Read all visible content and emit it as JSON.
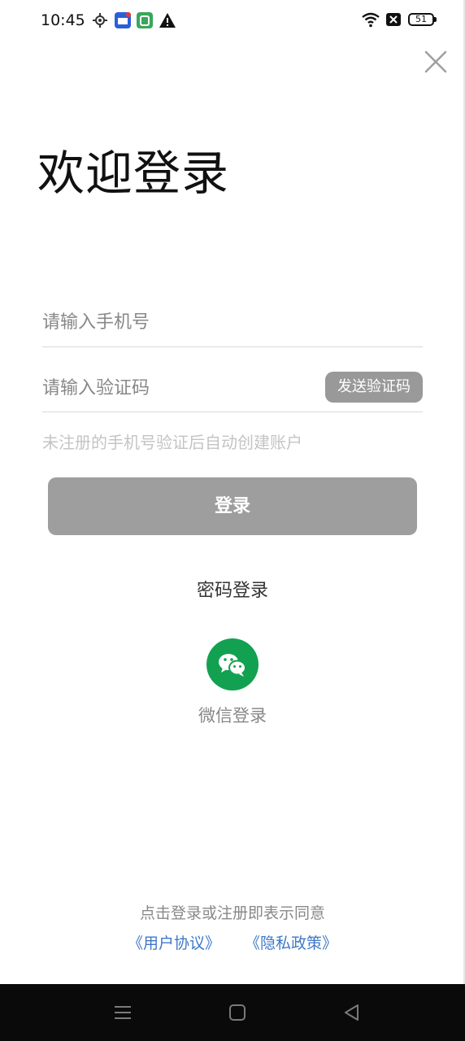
{
  "status_bar": {
    "time": "10:45",
    "battery_level": "51",
    "icons": [
      "location-icon",
      "app-notification-icon",
      "app-store-icon",
      "warning-icon",
      "wifi-icon",
      "no-sim-icon",
      "battery-icon"
    ]
  },
  "header": {
    "title": "欢迎登录",
    "close_icon": "close-icon"
  },
  "form": {
    "phone_placeholder": "请输入手机号",
    "phone_value": "",
    "code_placeholder": "请输入验证码",
    "code_value": "",
    "send_code_label": "发送验证码",
    "hint": "未注册的手机号验证后自动创建账户",
    "login_label": "登录"
  },
  "alt_login": {
    "password_login": "密码登录",
    "wechat_icon": "wechat-icon",
    "wechat_label": "微信登录"
  },
  "agreement": {
    "text": "点击登录或注册即表示同意",
    "user_agreement": "《用户协议》",
    "privacy_policy": "《隐私政策》",
    "link_color": "#3f78c7"
  },
  "colors": {
    "button_gray": "#9e9e9e",
    "wechat_green": "#12a150",
    "nav_bar": "#0a0a0a"
  }
}
